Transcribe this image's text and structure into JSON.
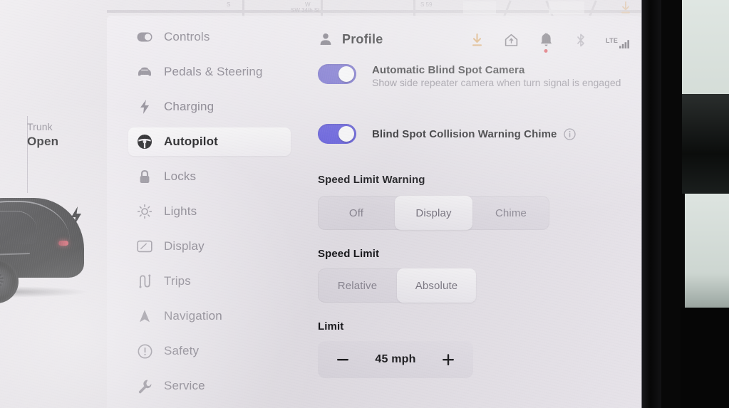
{
  "vehicle_panel": {
    "status_label": "Trunk",
    "status_value": "Open",
    "charge_icon": "lightning-bolt-icon",
    "car_icon": "tesla-car-side-view"
  },
  "map_strip": {
    "labels": [
      "S",
      "W",
      "SW 34th St",
      "S 59"
    ],
    "download_icon": "download-arrow-icon"
  },
  "sidebar": {
    "items": [
      {
        "label": "Controls",
        "icon": "toggle-switch-icon",
        "active": false
      },
      {
        "label": "Pedals & Steering",
        "icon": "car-front-icon",
        "active": false
      },
      {
        "label": "Charging",
        "icon": "lightning-bolt-icon",
        "active": false
      },
      {
        "label": "Autopilot",
        "icon": "steering-wheel-icon",
        "active": true
      },
      {
        "label": "Locks",
        "icon": "padlock-icon",
        "active": false
      },
      {
        "label": "Lights",
        "icon": "brightness-sun-icon",
        "active": false
      },
      {
        "label": "Display",
        "icon": "display-screen-icon",
        "active": false
      },
      {
        "label": "Trips",
        "icon": "winding-road-icon",
        "active": false
      },
      {
        "label": "Navigation",
        "icon": "navigation-arrow-icon",
        "active": false
      },
      {
        "label": "Safety",
        "icon": "alert-circle-icon",
        "active": false
      },
      {
        "label": "Service",
        "icon": "wrench-icon",
        "active": false
      }
    ]
  },
  "header": {
    "profile_icon": "person-icon",
    "title": "Profile",
    "status_icons": [
      {
        "name": "download-arrow-icon",
        "color": "#d79a52",
        "badge": false
      },
      {
        "name": "home-icon",
        "color": "#5c5862",
        "badge": false
      },
      {
        "name": "bell-icon",
        "color": "#5c5862",
        "badge": true,
        "badge_color": "#d8343f"
      },
      {
        "name": "bluetooth-icon",
        "color": "#a9a5b0",
        "badge": false
      },
      {
        "name": "lte-signal-icon",
        "color": "#5c5862",
        "badge": false,
        "text": "LTE"
      }
    ]
  },
  "settings": {
    "toggles": [
      {
        "title": "Automatic Blind Spot Camera",
        "subtitle": "Show side repeater camera when turn signal is engaged",
        "state": "on",
        "color": "#6b63cf",
        "has_info": false
      },
      {
        "title": "Blind Spot Collision Warning Chime",
        "subtitle": "",
        "state": "on",
        "color": "#5a52e0",
        "has_info": true,
        "info_icon": "info-circle-icon"
      }
    ],
    "speed_limit_warning": {
      "label": "Speed Limit Warning",
      "options": [
        "Off",
        "Display",
        "Chime"
      ],
      "selected": "Display"
    },
    "speed_limit": {
      "label": "Speed Limit",
      "options": [
        "Relative",
        "Absolute"
      ],
      "selected": "Absolute"
    },
    "limit": {
      "label": "Limit",
      "decrement_icon": "minus-icon",
      "increment_icon": "plus-icon",
      "value": "45 mph"
    }
  }
}
